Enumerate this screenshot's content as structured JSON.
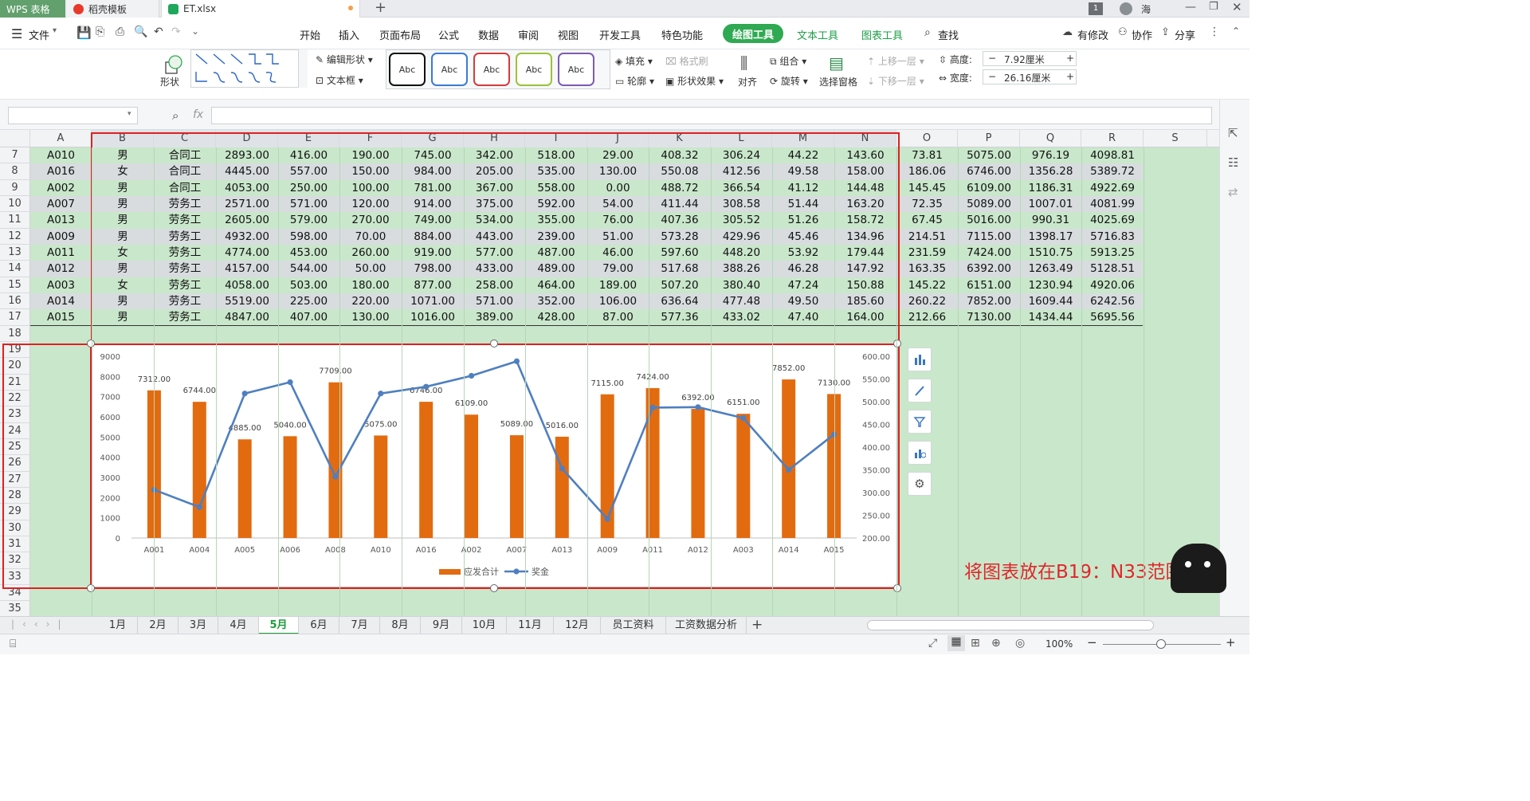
{
  "window": {
    "app_tab": "WPS 表格",
    "tab2": "稻壳模板",
    "tab3": "ET.xlsx",
    "add_tab": "+",
    "badge": "1",
    "user": "海"
  },
  "menu": {
    "file": "文件",
    "items": [
      "开始",
      "插入",
      "页面布局",
      "公式",
      "数据",
      "审阅",
      "视图",
      "开发工具",
      "特色功能"
    ],
    "context_tabs": [
      "绘图工具",
      "文本工具",
      "图表工具"
    ],
    "search": "查找",
    "right": [
      "有修改",
      "协作",
      "分享"
    ]
  },
  "ribbon": {
    "shape": "形状",
    "edit_shape": "编辑形状",
    "textbox": "文本框",
    "styles": [
      "Abc",
      "Abc",
      "Abc",
      "Abc",
      "Abc"
    ],
    "fill": "填充",
    "format_brush": "格式刷",
    "outline": "轮廓",
    "shape_effect": "形状效果",
    "align": "对齐",
    "group": "组合",
    "rotate": "旋转",
    "selection_pane": "选择窗格",
    "bring_forward": "上移一层",
    "send_backward": "下移一层",
    "height_label": "高度:",
    "height_value": "7.92厘米",
    "width_label": "宽度:",
    "width_value": "26.16厘米"
  },
  "formula": {
    "fx": "fx",
    "name_box": "",
    "value": ""
  },
  "sheet": {
    "columns": [
      "A",
      "B",
      "C",
      "D",
      "E",
      "F",
      "G",
      "H",
      "I",
      "J",
      "K",
      "L",
      "M",
      "N",
      "O",
      "P",
      "Q",
      "R",
      "S"
    ],
    "row_numbers": [
      "7",
      "8",
      "9",
      "10",
      "11",
      "12",
      "13",
      "14",
      "15",
      "16",
      "17",
      "18",
      "19",
      "20",
      "21",
      "22",
      "23",
      "24",
      "25",
      "26",
      "27",
      "28",
      "29",
      "30",
      "31",
      "32",
      "33",
      "34",
      "35"
    ],
    "rows": [
      [
        "A010",
        "男",
        "合同工",
        "2893.00",
        "416.00",
        "190.00",
        "745.00",
        "342.00",
        "518.00",
        "29.00",
        "408.32",
        "306.24",
        "44.22",
        "143.60",
        "73.81",
        "5075.00",
        "976.19",
        "4098.81"
      ],
      [
        "A016",
        "女",
        "合同工",
        "4445.00",
        "557.00",
        "150.00",
        "984.00",
        "205.00",
        "535.00",
        "130.00",
        "550.08",
        "412.56",
        "49.58",
        "158.00",
        "186.06",
        "6746.00",
        "1356.28",
        "5389.72"
      ],
      [
        "A002",
        "男",
        "合同工",
        "4053.00",
        "250.00",
        "100.00",
        "781.00",
        "367.00",
        "558.00",
        "0.00",
        "488.72",
        "366.54",
        "41.12",
        "144.48",
        "145.45",
        "6109.00",
        "1186.31",
        "4922.69"
      ],
      [
        "A007",
        "男",
        "劳务工",
        "2571.00",
        "571.00",
        "120.00",
        "914.00",
        "375.00",
        "592.00",
        "54.00",
        "411.44",
        "308.58",
        "51.44",
        "163.20",
        "72.35",
        "5089.00",
        "1007.01",
        "4081.99"
      ],
      [
        "A013",
        "男",
        "劳务工",
        "2605.00",
        "579.00",
        "270.00",
        "749.00",
        "534.00",
        "355.00",
        "76.00",
        "407.36",
        "305.52",
        "51.26",
        "158.72",
        "67.45",
        "5016.00",
        "990.31",
        "4025.69"
      ],
      [
        "A009",
        "男",
        "劳务工",
        "4932.00",
        "598.00",
        "70.00",
        "884.00",
        "443.00",
        "239.00",
        "51.00",
        "573.28",
        "429.96",
        "45.46",
        "134.96",
        "214.51",
        "7115.00",
        "1398.17",
        "5716.83"
      ],
      [
        "A011",
        "女",
        "劳务工",
        "4774.00",
        "453.00",
        "260.00",
        "919.00",
        "577.00",
        "487.00",
        "46.00",
        "597.60",
        "448.20",
        "53.92",
        "179.44",
        "231.59",
        "7424.00",
        "1510.75",
        "5913.25"
      ],
      [
        "A012",
        "男",
        "劳务工",
        "4157.00",
        "544.00",
        "50.00",
        "798.00",
        "433.00",
        "489.00",
        "79.00",
        "517.68",
        "388.26",
        "46.28",
        "147.92",
        "163.35",
        "6392.00",
        "1263.49",
        "5128.51"
      ],
      [
        "A003",
        "女",
        "劳务工",
        "4058.00",
        "503.00",
        "180.00",
        "877.00",
        "258.00",
        "464.00",
        "189.00",
        "507.20",
        "380.40",
        "47.24",
        "150.88",
        "145.22",
        "6151.00",
        "1230.94",
        "4920.06"
      ],
      [
        "A014",
        "男",
        "劳务工",
        "5519.00",
        "225.00",
        "220.00",
        "1071.00",
        "571.00",
        "352.00",
        "106.00",
        "636.64",
        "477.48",
        "49.50",
        "185.60",
        "260.22",
        "7852.00",
        "1609.44",
        "6242.56"
      ],
      [
        "A015",
        "男",
        "劳务工",
        "4847.00",
        "407.00",
        "130.00",
        "1016.00",
        "389.00",
        "428.00",
        "87.00",
        "577.36",
        "433.02",
        "47.40",
        "164.00",
        "212.66",
        "7130.00",
        "1434.44",
        "5695.56"
      ]
    ],
    "annotation": "将图表放在B19：N33范围"
  },
  "chart_data": {
    "type": "bar",
    "categories": [
      "A001",
      "A004",
      "A005",
      "A006",
      "A008",
      "A010",
      "A016",
      "A002",
      "A007",
      "A013",
      "A009",
      "A011",
      "A012",
      "A003",
      "A014",
      "A015"
    ],
    "series": [
      {
        "name": "应发合计",
        "type": "bar",
        "axis": "left",
        "values": [
          7312,
          6744,
          4885,
          5040,
          7709,
          5075,
          6746,
          6109,
          5089,
          5016,
          7115,
          7424,
          6392,
          6151,
          7852,
          7130
        ],
        "labels": [
          "7312.00",
          "6744.00",
          "4885.00",
          "5040.00",
          "7709.00",
          "5075.00",
          "6746.00",
          "6109.00",
          "5089.00",
          "5016.00",
          "7115.00",
          "7424.00",
          "6392.00",
          "6151.00",
          "7852.00",
          "7130.00"
        ],
        "color": "#e26b10"
      },
      {
        "name": "奖金",
        "type": "line",
        "axis": "right",
        "values": [
          306,
          268,
          518,
          543,
          335,
          518,
          533,
          557,
          589,
          353,
          242,
          487,
          488,
          464,
          350,
          428
        ],
        "color": "#4f7fc0"
      }
    ],
    "y_left": {
      "min": 0,
      "max": 9000,
      "ticks": [
        "0",
        "1000",
        "2000",
        "3000",
        "4000",
        "5000",
        "6000",
        "7000",
        "8000",
        "9000"
      ]
    },
    "y_right": {
      "min": 200,
      "max": 600,
      "ticks": [
        "200.00",
        "250.00",
        "300.00",
        "350.00",
        "400.00",
        "450.00",
        "500.00",
        "550.00",
        "600.00"
      ]
    },
    "legend": "bottom",
    "grid": false
  },
  "sheet_tabs": [
    "1月",
    "2月",
    "3月",
    "4月",
    "5月",
    "6月",
    "7月",
    "8月",
    "9月",
    "10月",
    "11月",
    "12月",
    "员工资料",
    "工资数据分析"
  ],
  "active_sheet": "5月",
  "status": {
    "zoom": "100%"
  }
}
